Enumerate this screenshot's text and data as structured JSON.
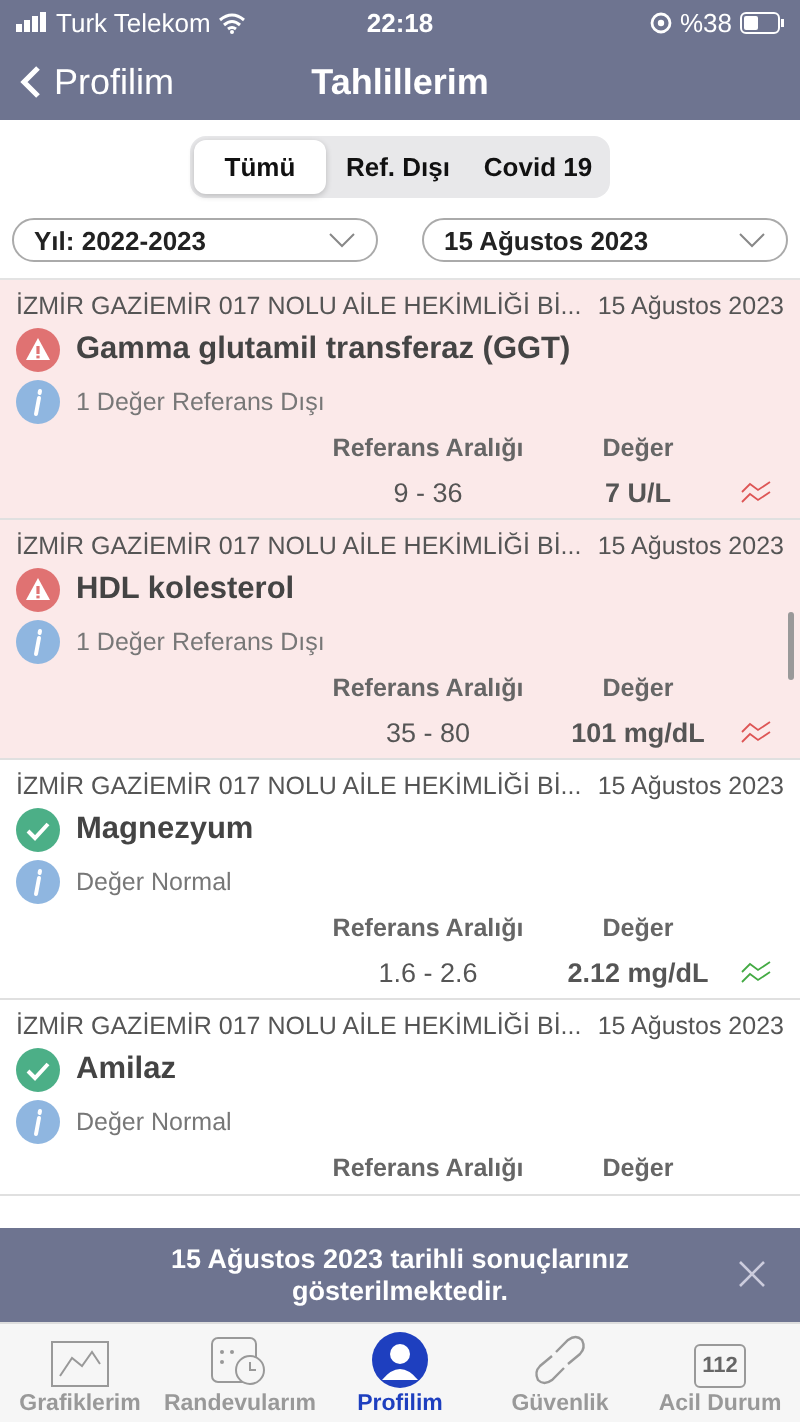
{
  "status_bar": {
    "carrier": "Turk Telekom",
    "time": "22:18",
    "battery": "%38"
  },
  "nav": {
    "back": "Profilim",
    "title": "Tahlillerim"
  },
  "segments": [
    {
      "label": "Tümü",
      "selected": true
    },
    {
      "label": "Ref. Dışı",
      "selected": false
    },
    {
      "label": "Covid 19",
      "selected": false
    }
  ],
  "filters": [
    {
      "value": "Yıl: 2022-2023"
    },
    {
      "value": "15 Ağustos 2023"
    }
  ],
  "results": [
    {
      "kind": "abnormal",
      "source": "İZMİR GAZİEMİR 017 NOLU AİLE HEKİMLİĞİ Bİ...",
      "date": "15 Ağustos 2023",
      "name": "Gamma glutamil transferaz (GGT)",
      "note": "1 Değer Referans Dışı",
      "range_label": "Referans Aralığı",
      "value_label": "Değer",
      "range": "9 - 36",
      "value": "7 U/L"
    },
    {
      "kind": "abnormal",
      "source": "İZMİR GAZİEMİR 017 NOLU AİLE HEKİMLİĞİ Bİ...",
      "date": "15 Ağustos 2023",
      "name": "HDL kolesterol",
      "note": "1 Değer Referans Dışı",
      "range_label": "Referans Aralığı",
      "value_label": "Değer",
      "range": "35 - 80",
      "value": "101 mg/dL"
    },
    {
      "kind": "normal",
      "source": "İZMİR GAZİEMİR 017 NOLU AİLE HEKİMLİĞİ Bİ...",
      "date": "15 Ağustos 2023",
      "name": "Magnezyum",
      "note": "Değer Normal",
      "range_label": "Referans Aralığı",
      "value_label": "Değer",
      "range": "1.6 - 2.6",
      "value": "2.12 mg/dL"
    },
    {
      "kind": "normal",
      "source": "İZMİR GAZİEMİR 017 NOLU AİLE HEKİMLİĞİ Bİ...",
      "date": "15 Ağustos 2023",
      "name": "Amilaz",
      "note": "Değer Normal",
      "range_label": "Referans Aralığı",
      "value_label": "Değer"
    }
  ],
  "toast": {
    "message": "15 Ağustos 2023 tarihli sonuçlarınız gösterilmektedir."
  },
  "tab_bar": [
    {
      "kind": "chart",
      "label": "Grafiklerim",
      "selected": false
    },
    {
      "kind": "calendar",
      "label": "Randevularım",
      "selected": false
    },
    {
      "kind": "profile",
      "label": "Profilim",
      "selected": true
    },
    {
      "kind": "link",
      "label": "Güvenlik",
      "selected": false
    },
    {
      "kind": "emergency",
      "label": "Acil Durum",
      "badge": "112",
      "selected": false
    }
  ]
}
